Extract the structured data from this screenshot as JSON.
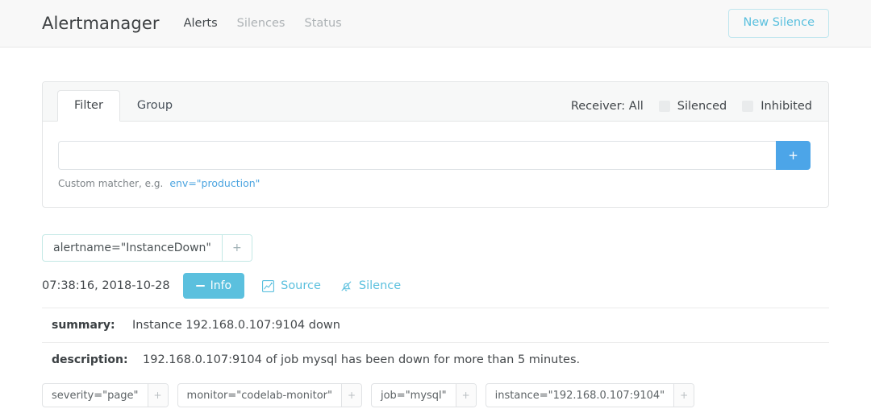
{
  "navbar": {
    "brand": "Alertmanager",
    "links": [
      {
        "label": "Alerts",
        "active": true
      },
      {
        "label": "Silences",
        "active": false
      },
      {
        "label": "Status",
        "active": false
      }
    ],
    "new_silence_label": "New Silence",
    "accent_color": "#5bc0de"
  },
  "filter_card": {
    "tabs": [
      {
        "label": "Filter",
        "active": true
      },
      {
        "label": "Group",
        "active": false
      }
    ],
    "receiver_label": "Receiver: All",
    "checkboxes": [
      {
        "label": "Silenced",
        "checked": false
      },
      {
        "label": "Inhibited",
        "checked": false
      }
    ],
    "matcher_input": {
      "value": "",
      "placeholder": ""
    },
    "add_button_label": "+",
    "help_prefix": "Custom matcher, e.g.",
    "help_example": "env=\"production\"",
    "help_example_color": "#4ba4e0"
  },
  "group": {
    "matcher_pill": {
      "text": "alertname=\"InstanceDown\"",
      "add_label": "+"
    }
  },
  "alert": {
    "timestamp": "07:38:16, 2018-10-28",
    "info_button_label": "Info",
    "source_link_label": "Source",
    "silence_link_label": "Silence",
    "annotations": [
      {
        "key": "summary:",
        "value": "Instance 192.168.0.107:9104 down"
      },
      {
        "key": "description:",
        "value": "192.168.0.107:9104 of job mysql has been down for more than 5 minutes."
      }
    ],
    "labels": [
      {
        "text": "severity=\"page\"",
        "add_label": "+"
      },
      {
        "text": "monitor=\"codelab-monitor\"",
        "add_label": "+"
      },
      {
        "text": "job=\"mysql\"",
        "add_label": "+"
      },
      {
        "text": "instance=\"192.168.0.107:9104\"",
        "add_label": "+"
      }
    ]
  }
}
